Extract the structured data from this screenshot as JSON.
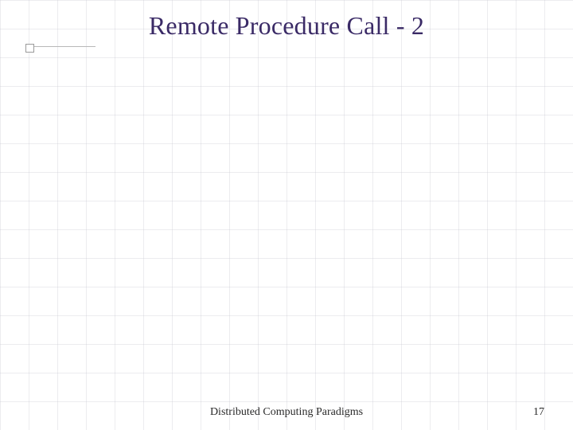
{
  "slide": {
    "title": "Remote Procedure Call - 2",
    "footer_center": "Distributed Computing Paradigms",
    "page_number": "17"
  }
}
